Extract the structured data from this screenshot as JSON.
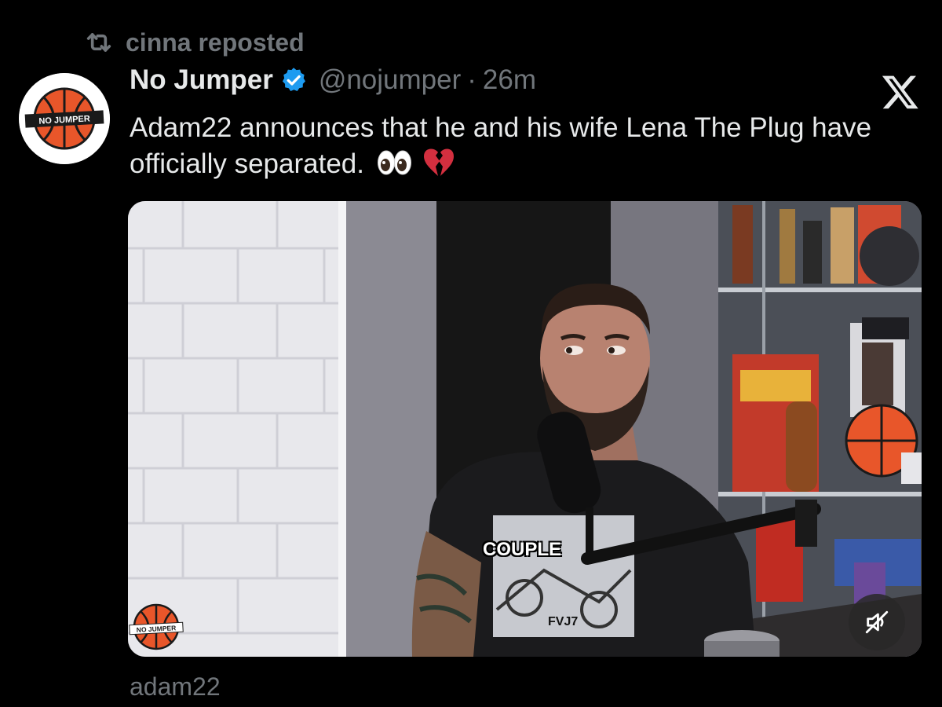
{
  "repost": {
    "label": "cinna reposted",
    "icon": "repost-icon"
  },
  "tweet": {
    "author": {
      "display_name": "No Jumper",
      "handle": "@nojumper",
      "verified": true,
      "avatar_text": "NO JUMPER"
    },
    "separator": "·",
    "timestamp": "26m",
    "text": "Adam22 announces that he and his wife Lena The Plug have officially separated.",
    "emojis": [
      "eyes",
      "broken-heart"
    ]
  },
  "media": {
    "caption": "COUPLE",
    "watermark_text": "NO JUMPER",
    "shirt_text": "FVJ7",
    "mute_icon": "speaker-muted-icon"
  },
  "source_credit": "adam22",
  "colors": {
    "background": "#000000",
    "text_primary": "#e7e9ea",
    "text_secondary": "#71767b",
    "verified": "#1d9bf0",
    "brand_orange": "#e8562a"
  }
}
